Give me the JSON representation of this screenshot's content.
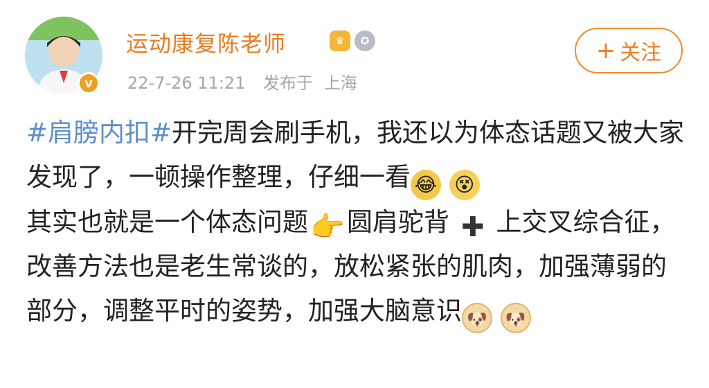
{
  "post": {
    "author": {
      "name": "运动康复陈老师",
      "verified_icon": "verified-v-icon",
      "badges": [
        "crown-badge-icon",
        "medal-badge-icon"
      ]
    },
    "meta": {
      "time": "22-7-26 11:21",
      "location_prefix": "发布于",
      "location": "上海"
    },
    "follow_button": {
      "plus": "+",
      "label": "关注"
    },
    "content": {
      "hashtag": "#肩膀内扣#",
      "seg1": "开完周会刷手机，我还以为体态话题又被大家发现了，一顿操作整理，仔细一看",
      "seg2": "其实也就是一个体态问题",
      "seg3": "圆肩驼背",
      "seg4": "上交叉综合征，改善方法也是老生常谈的，放松紧张的肌肉，加强薄弱的部分，调整平时的姿势，加强大脑意识"
    },
    "emoji_icons": [
      "laugh-cry-emoji-icon",
      "dizzy-emoji-icon",
      "pointing-hand-emoji-icon",
      "plus-sign-icon",
      "doge-emoji-icon",
      "doge-emoji-icon"
    ]
  }
}
